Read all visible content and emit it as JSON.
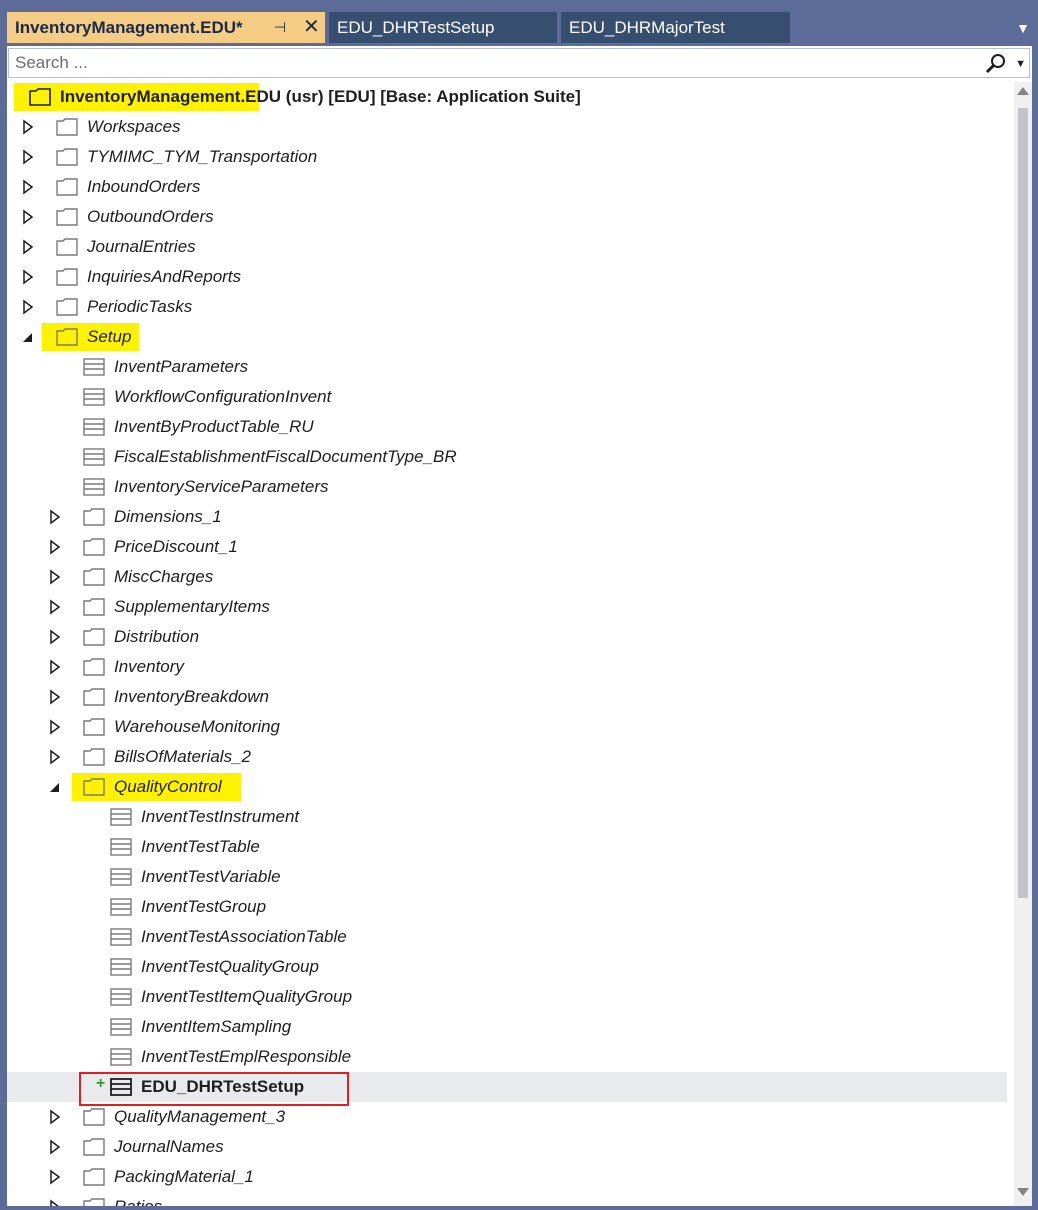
{
  "tabs": [
    {
      "label": "InventoryManagement.EDU*",
      "active": true
    },
    {
      "label": "EDU_DHRTestSetup",
      "active": false
    },
    {
      "label": "EDU_DHRMajorTest",
      "active": false
    }
  ],
  "icons": {
    "pin": "pin-icon",
    "close": "close-icon",
    "tab_overflow": "chevron-down-icon",
    "search": "search-icon",
    "folder": "folder-icon",
    "table": "table-icon"
  },
  "search": {
    "placeholder": "Search ..."
  },
  "tree": {
    "root": {
      "label_part1": "InventoryManagement",
      "label_part2": ".EDU (usr) [EDU] [Base: Application Suite]"
    },
    "level1": [
      {
        "label": "Workspaces",
        "expanded": false
      },
      {
        "label": "TYMIMC_TYM_Transportation",
        "expanded": false
      },
      {
        "label": "InboundOrders",
        "expanded": false
      },
      {
        "label": "OutboundOrders",
        "expanded": false
      },
      {
        "label": "JournalEntries",
        "expanded": false
      },
      {
        "label": "InquiriesAndReports",
        "expanded": false
      },
      {
        "label": "PeriodicTasks",
        "expanded": false
      },
      {
        "label": "Setup",
        "expanded": true
      }
    ],
    "setup_tables": [
      "InventParameters",
      "WorkflowConfigurationInvent",
      "InventByProductTable_RU",
      "FiscalEstablishmentFiscalDocumentType_BR",
      "InventoryServiceParameters"
    ],
    "setup_folders": [
      "Dimensions_1",
      "PriceDiscount_1",
      "MiscCharges",
      "SupplementaryItems",
      "Distribution",
      "Inventory",
      "InventoryBreakdown",
      "WarehouseMonitoring",
      "BillsOfMaterials_2"
    ],
    "quality_control": {
      "label": "QualityControl",
      "expanded": true
    },
    "qc_tables": [
      "InventTestInstrument",
      "InventTestTable",
      "InventTestVariable",
      "InventTestGroup",
      "InventTestAssociationTable",
      "InventTestQualityGroup",
      "InventTestItemQualityGroup",
      "InventItemSampling",
      "InventTestEmplResponsible"
    ],
    "new_item": {
      "label": "EDU_DHRTestSetup",
      "marker": "+"
    },
    "after_folders": [
      "QualityManagement_3",
      "JournalNames",
      "PackingMaterial_1",
      "Ratios"
    ]
  },
  "colors": {
    "highlight": "#fef200",
    "red_box": "#e02020",
    "active_tab": "#f5cc84",
    "inactive_tab": "#364e6f",
    "frame": "#5d6b99"
  }
}
